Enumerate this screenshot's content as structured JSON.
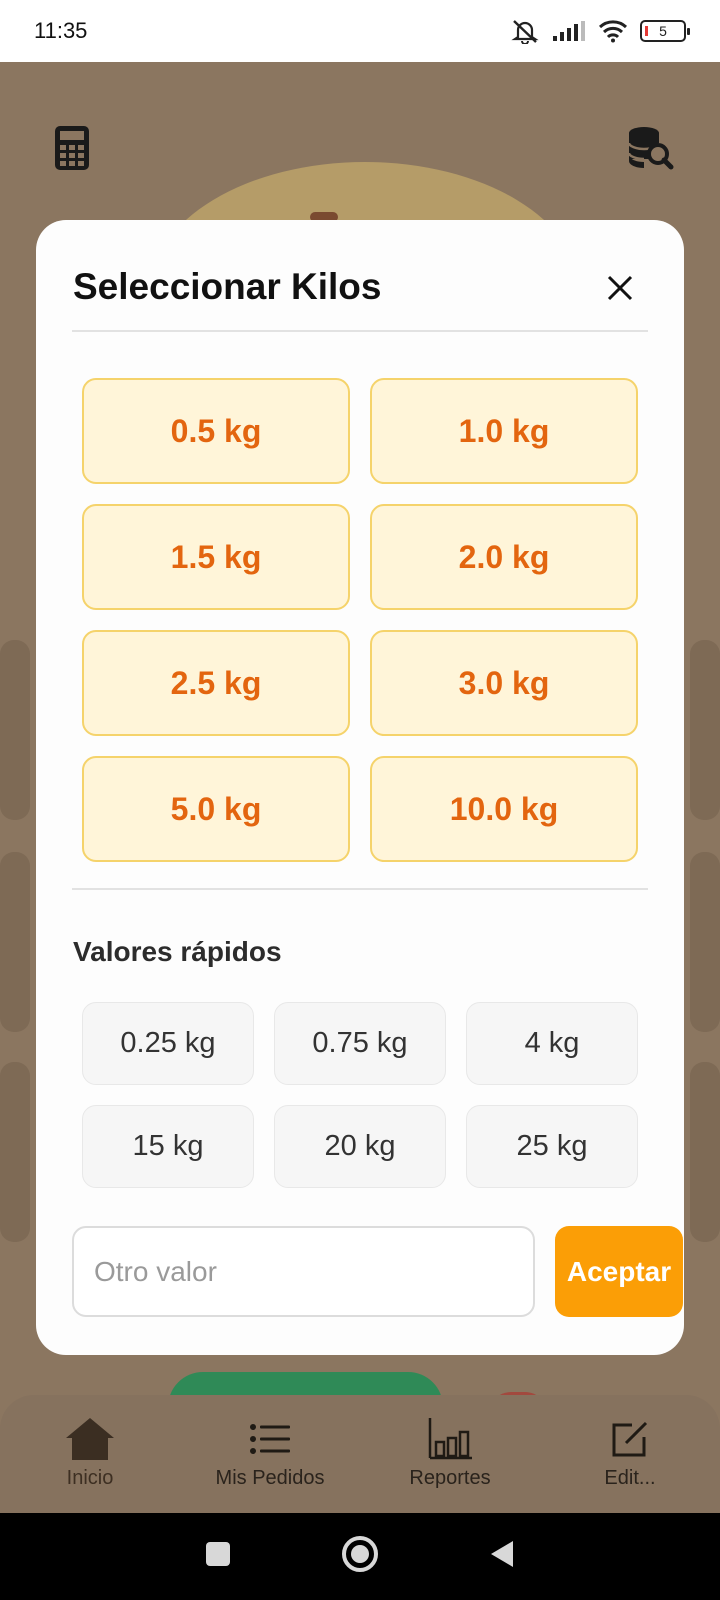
{
  "status_bar": {
    "time": "11:35",
    "battery_level": "5",
    "icons": [
      "mute-icon",
      "signal-icon",
      "wifi-icon",
      "battery-icon"
    ]
  },
  "background": {
    "top_left_icon": "calculator-icon",
    "top_right_icon": "database-search-icon"
  },
  "dialog": {
    "title": "Seleccionar Kilos",
    "close_icon": "close-icon",
    "kg_options": [
      "0.5 kg",
      "1.0 kg",
      "1.5 kg",
      "2.0 kg",
      "2.5 kg",
      "3.0 kg",
      "5.0 kg",
      "10.0 kg"
    ],
    "quick_title": "Valores rápidos",
    "quick_values": [
      "0.25 kg",
      "0.75 kg",
      "4 kg",
      "15 kg",
      "20 kg",
      "25 kg"
    ],
    "input_placeholder": "Otro valor",
    "accept_label": "Aceptar"
  },
  "bottom_nav": {
    "items": [
      {
        "label": "Inicio",
        "icon": "home-icon",
        "active": true
      },
      {
        "label": "Mis Pedidos",
        "icon": "list-icon",
        "active": false
      },
      {
        "label": "Reportes",
        "icon": "bar-chart-icon",
        "active": false
      },
      {
        "label": "Edit...",
        "icon": "edit-icon",
        "active": false
      }
    ]
  },
  "system_nav": [
    "recents-button",
    "home-button",
    "back-button"
  ],
  "colors": {
    "accent_orange": "#fb9e06",
    "kg_text": "#e3650f",
    "kg_bg": "#fff5d9",
    "kg_border": "#f5d36b",
    "overlay": "#8b7660"
  }
}
